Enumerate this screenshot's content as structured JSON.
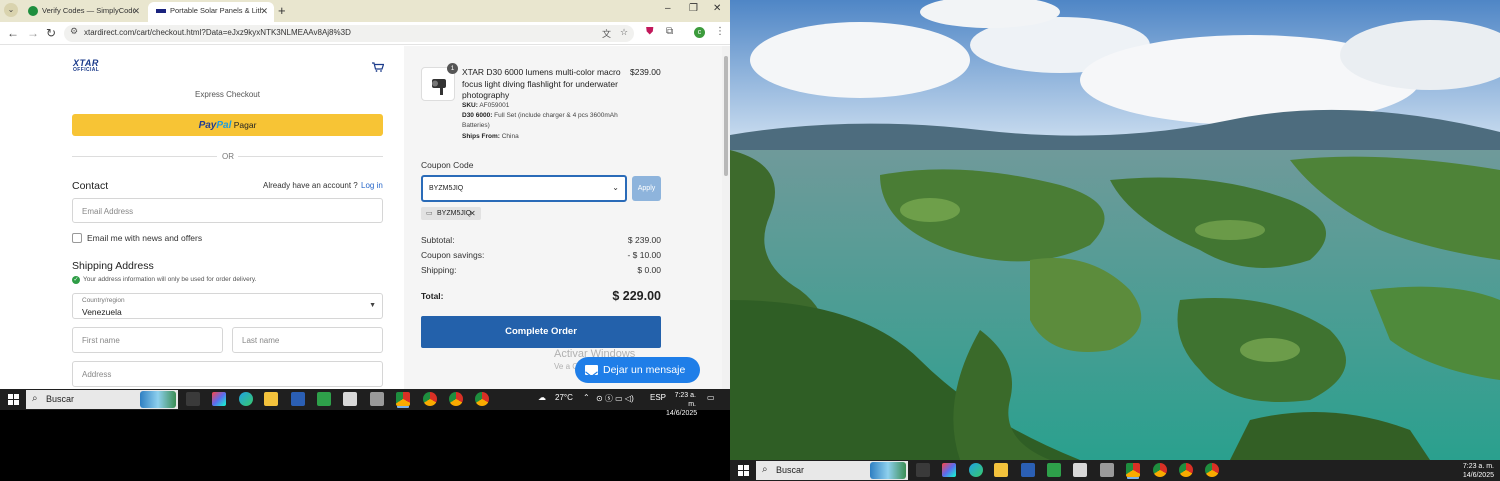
{
  "browser": {
    "tabs": [
      {
        "label": "Verify Codes — SimplyCodes"
      },
      {
        "label": "Portable Solar Panels & Lithium"
      }
    ],
    "new_tab": "+",
    "window_controls": {
      "minimize": "–",
      "maximize": "❐",
      "close": "✕"
    },
    "url": "xtardirect.com/cart/checkout.html?Data=eJxz9kyxNTK3NLMEAAv8Aj8%3D"
  },
  "checkout": {
    "brand": {
      "line1": "XTAR",
      "line2": "OFFICIAL"
    },
    "express_label": "Express Checkout",
    "paypal": {
      "pay": "Pay",
      "pal": "Pal",
      "label": "Pagar"
    },
    "or_text": "OR",
    "contact_heading": "Contact",
    "account_prompt": "Already have an account ?",
    "login_link": "Log in",
    "email_placeholder": "Email Address",
    "newsletter_label": "Email me with news and offers",
    "shipping_heading": "Shipping Address",
    "shipping_note": "Your address information will only be used for order delivery.",
    "country_label": "Country/region",
    "country_value": "Venezuela",
    "first_name_placeholder": "First name",
    "last_name_placeholder": "Last name",
    "address_placeholder": "Address"
  },
  "order": {
    "quantity": "1",
    "title": "XTAR D30 6000 lumens multi-color macro focus light diving flashlight for underwater photography",
    "price": "$239.00",
    "sku_label": "SKU:",
    "sku": "AF059001",
    "variant_label": "D30 6000:",
    "variant": "Full Set (include charger & 4 pcs 3600mAh Batteries)",
    "ships_label": "Ships From:",
    "ships_from": "China",
    "coupon_label": "Coupon Code",
    "coupon_value": "BYZM5JIQ",
    "apply_label": "Apply",
    "applied_coupon": "BYZM5JIQ",
    "summary": {
      "subtotal_label": "Subtotal:",
      "subtotal": "$ 239.00",
      "savings_label": "Coupon savings:",
      "savings": "- $ 10.00",
      "shipping_label": "Shipping:",
      "shipping": "$ 0.00",
      "total_label": "Total:",
      "total": "$ 229.00"
    },
    "complete_label": "Complete Order"
  },
  "overlay": {
    "activate_line1": "Activar Windows",
    "activate_line2": "Ve a C",
    "chat_label": "Dejar un mensaje"
  },
  "taskbar_left": {
    "search_placeholder": "Buscar",
    "temperature": "27°C",
    "language": "ESP",
    "time": "7:23 a. m.",
    "date": "14/6/2025"
  },
  "taskbar_right": {
    "search_placeholder": "Buscar",
    "time": "7:23 a. m.",
    "date": "14/6/2025"
  },
  "colors": {
    "paypal_yellow": "#f7c435",
    "primary_blue": "#2361ab",
    "chat_blue": "#1f7ee8",
    "apply_disabled": "#8eb4dc"
  }
}
